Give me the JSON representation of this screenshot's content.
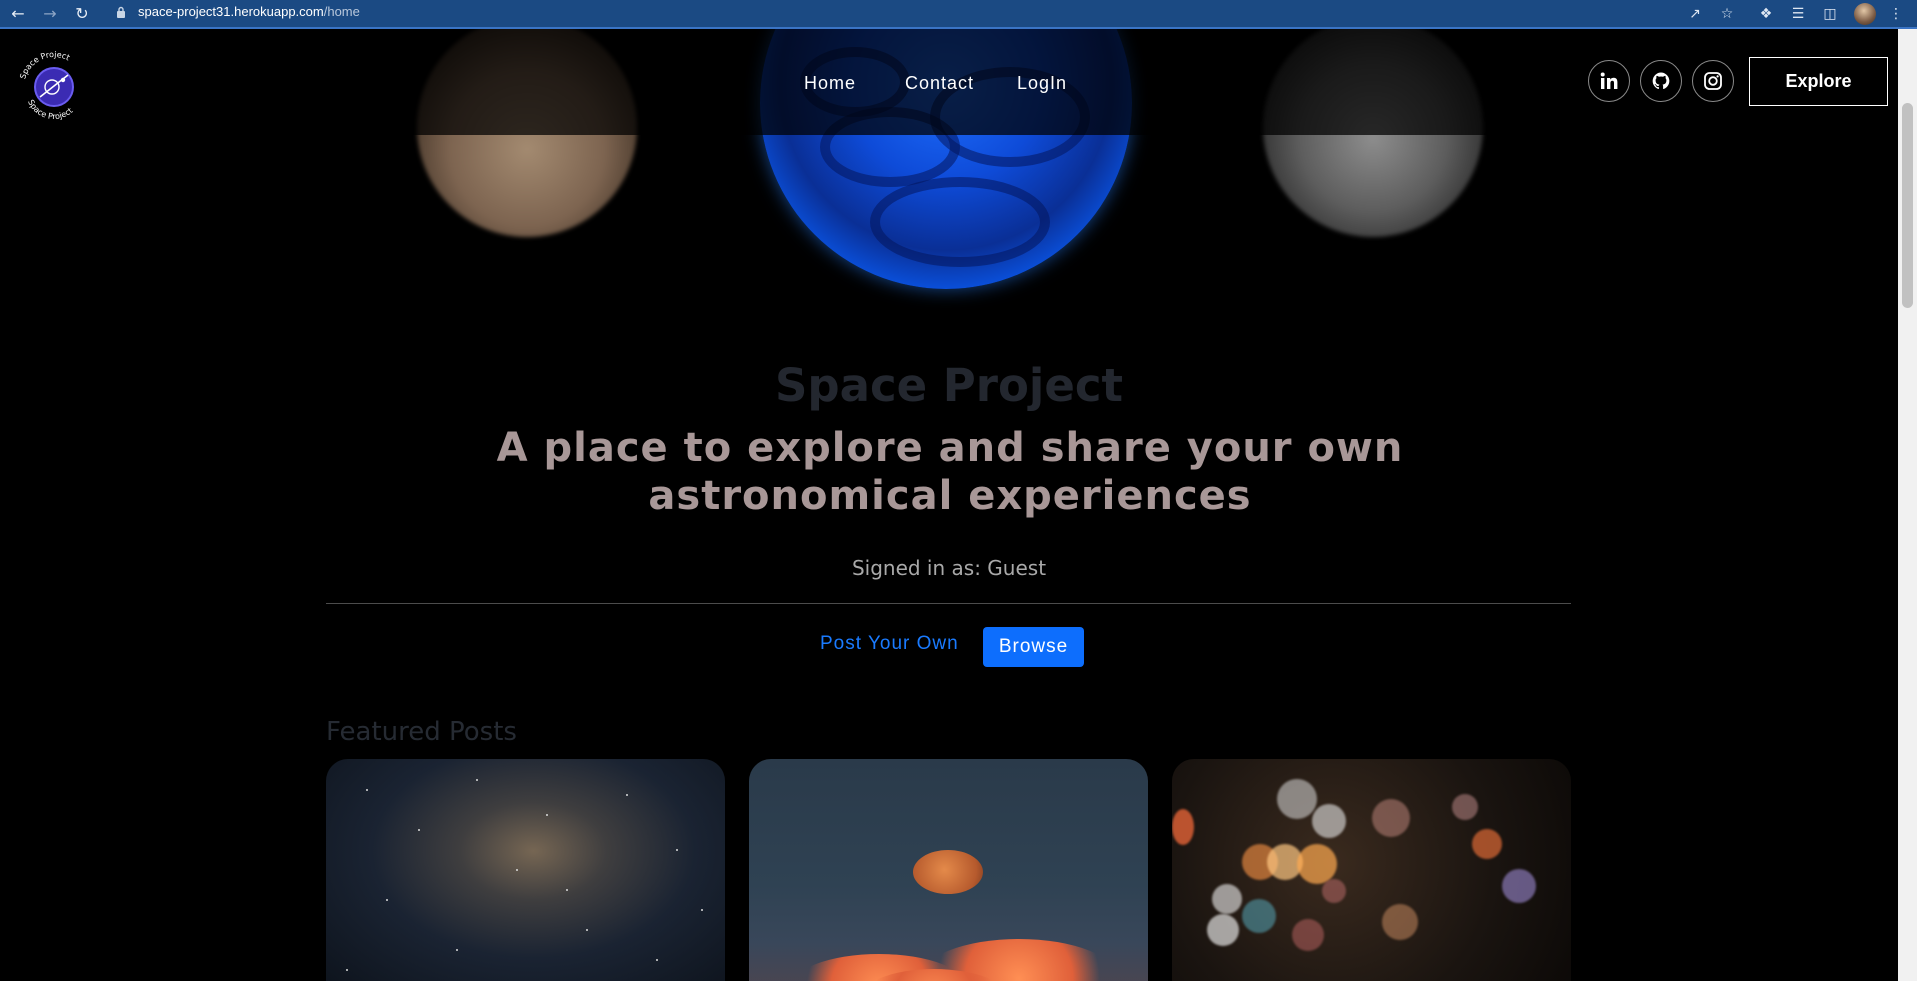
{
  "browser": {
    "url_host": "space-project31.herokuapp.com",
    "url_path": "/home"
  },
  "header": {
    "nav": [
      {
        "label": "Home"
      },
      {
        "label": "Contact"
      },
      {
        "label": "LogIn"
      }
    ],
    "social": [
      {
        "icon": "linkedin-icon"
      },
      {
        "icon": "github-icon"
      },
      {
        "icon": "instagram-icon"
      }
    ],
    "explore_label": "Explore",
    "logo_text": "Space Project"
  },
  "hero": {
    "title": "Space Project",
    "tagline": "A place to explore and share your own astronomical experiences",
    "signed_in": "Signed in as: Guest"
  },
  "actions": {
    "post_own": "Post Your Own",
    "browse": "Browse"
  },
  "featured": {
    "heading": "Featured Posts"
  },
  "colors": {
    "accent": "#0d6efd",
    "background": "#000000",
    "chrome": "#1b4a83"
  }
}
